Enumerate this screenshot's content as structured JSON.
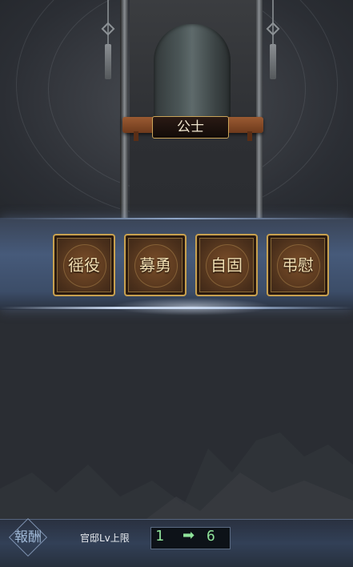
{
  "rank": {
    "name": "公士"
  },
  "rewards": [
    {
      "label": "徭役"
    },
    {
      "label": "募勇"
    },
    {
      "label": "自固"
    },
    {
      "label": "弔慰"
    }
  ],
  "footer": {
    "reward_button": "報酬",
    "cap_label": "官邸Lv上限",
    "cap_from": "1",
    "cap_to": "6",
    "arrow_glyph": "➡"
  },
  "colors": {
    "accent_gold": "#c8a14f",
    "value_green": "#8fe39a",
    "band_blue": "#465a7a"
  },
  "icons": [
    "hat-icon",
    "tassel-icon",
    "arrow-right-icon"
  ]
}
